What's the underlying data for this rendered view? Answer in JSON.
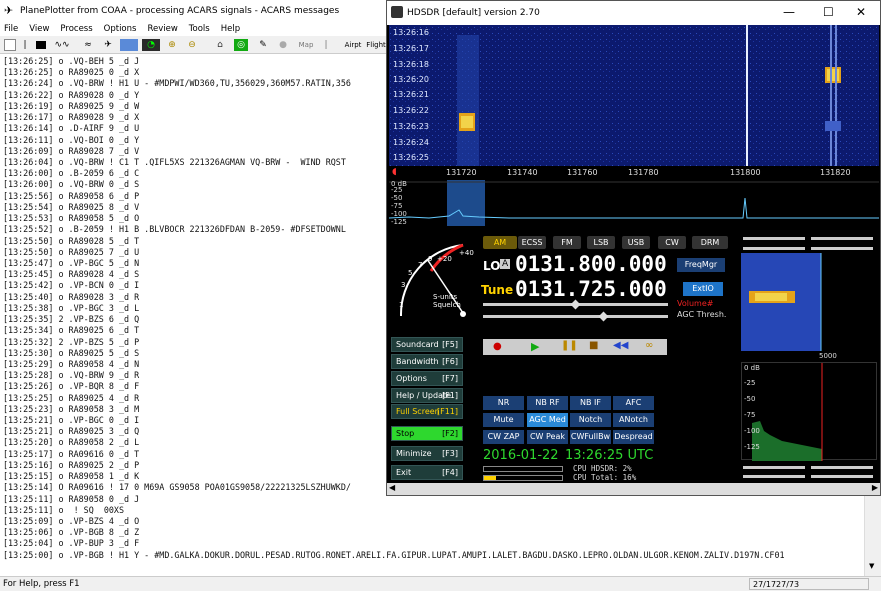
{
  "planeplotter": {
    "title": "PlanePlotter from COAA - processing ACARS signals - ACARS messages",
    "menu": [
      "File",
      "View",
      "Process",
      "Options",
      "Review",
      "Tools",
      "Help"
    ],
    "toolbar_labels": {
      "map": "Map",
      "airport": "Airpt",
      "flight": "Flight"
    },
    "log": [
      "[13:26:25] o .VQ-BEH 5 _d J",
      "[13:26:25] o RA89025 0 _d X",
      "[13:26:24] o .VQ-BRW ! H1 U - #MDPWI/WD360,TU,356029,360M57.RATIN,356",
      "[13:26:22] o RA89028 0 _d Y",
      "[13:26:19] o RA89025 9 _d W",
      "[13:26:17] o RA89028 9 _d X",
      "[13:26:14] o .D-AIRF 9 _d U",
      "[13:26:11] o .VQ-BOI 0 _d Y",
      "[13:26:09] o RA89028 7 _d V",
      "[13:26:04] o .VQ-BRW ! C1 T .QIFL5XS 221326AGMAN VQ-BRW -  WIND RQST",
      "[13:26:00] o .B-2059 6 _d C",
      "[13:26:00] o .VQ-BRW 0 _d S",
      "[13:25:56] o RA89058 6 _d P",
      "[13:25:54] o RA89025 8 _d V",
      "[13:25:53] o RA89058 5 _d O",
      "[13:25:52] o .B-2059 ! H1 B .BLVBOCR 221326DFDAN B-2059- #DFSETDOWNL",
      "[13:25:50] o RA89028 5 _d T",
      "[13:25:50] o RA89025 7 _d U",
      "[13:25:47] o .VP-BGC 5 _d N",
      "[13:25:45] o RA89028 4 _d S",
      "[13:25:42] o .VP-BCN 0 _d I",
      "[13:25:40] o RA89028 3 _d R",
      "[13:25:38] o .VP-BGC 3 _d L",
      "[13:25:35] 2 .VP-BZS 6 _d Q",
      "[13:25:34] o RA89025 6 _d T",
      "[13:25:32] 2 .VP-BZS 5 _d P",
      "[13:25:30] o RA89025 5 _d S",
      "[13:25:29] o RA89058 4 _d N",
      "[13:25:28] o .VQ-BRW 9 _d R",
      "[13:25:26] o .VP-BQR 8 _d F",
      "[13:25:25] o RA89025 4 _d R",
      "[13:25:23] o RA89058 3 _d M",
      "[13:25:21] o .VP-BGC 0 _d I",
      "[13:25:21] o RA89025 3 _d Q",
      "[13:25:20] o RA89058 2 _d L",
      "[13:25:17] o RA09616 0 _d T",
      "[13:25:16] o RA89025 2 _d P",
      "[13:25:15] o RA89058 1 _d K",
      "[13:25:14] O RA09616 ! 17 0 M69A GS9058 POA01GS9058/22221325LSZHUWKD/",
      "[13:25:11] o RA89058 0 _d J",
      "[13:25:11] o  ! SQ  00XS",
      "[13:25:09] o .VP-BZS 4 _d O",
      "[13:25:06] o .VP-BGB 8 _d Z",
      "[13:25:04] o .VP-BUP 3 _d F",
      "[13:25:00] o .VP-BGB ! H1 Y - #MD.GALKA.DOKUR.DORUL.PESAD.RUTOG.RONET.ARELI.FA.GIPUR.LUPAT.AMUPI.LALET.BAGDU.DASKO.LEPRO.OLDAN.ULGOR.KENOM.ZALIV.D197N.CF01"
    ],
    "status_help": "For Help, press F1",
    "status_count": "27/1727/73"
  },
  "hdsdr": {
    "title": "HDSDR [default]  version 2.70",
    "waterfall_times": [
      "13:26:16",
      "13:26:17",
      "13:26:18",
      "13:26:20",
      "13:26:21",
      "13:26:22",
      "13:26:23",
      "13:26:24",
      "13:26:25"
    ],
    "freq_axis": [
      "131720",
      "131740",
      "131760",
      "131780",
      "131800",
      "131820"
    ],
    "spectrum_db": [
      "-25",
      "-50",
      "-75",
      "-100",
      "-125"
    ],
    "spectrum_top_label": "0 dB",
    "modes": [
      "AM",
      "ECSS",
      "FM",
      "LSB",
      "USB",
      "CW",
      "DRM"
    ],
    "lo_label": "LO",
    "lo_a": "A",
    "lo_freq": "0131.800.000",
    "tune_label": "Tune",
    "tune_freq": "0131.725.000",
    "freqmgr": "FreqMgr",
    "extio": "ExtIO",
    "volume": "Volume#",
    "agc_thresh": "AGC Thresh.",
    "smeter_unit": "S-units",
    "smeter_squelch": "Squelch",
    "smeter_scale": [
      "1",
      "3",
      "5",
      "7",
      "9",
      "+20",
      "+40"
    ],
    "left_buttons": [
      {
        "label": "Soundcard",
        "key": "[F5]"
      },
      {
        "label": "Bandwidth",
        "key": "[F6]"
      },
      {
        "label": "Options",
        "key": "[F7]"
      },
      {
        "label": "Help / Update",
        "key": "[F1]"
      },
      {
        "label": "Full Screen",
        "key": "[F11]"
      },
      {
        "label": "Stop",
        "key": "[F2]"
      },
      {
        "label": "Minimize",
        "key": "[F3]"
      },
      {
        "label": "Exit",
        "key": "[F4]"
      }
    ],
    "dsp_buttons": [
      "NR",
      "NB RF",
      "NB IF",
      "AFC",
      "Mute",
      "AGC Med",
      "Notch",
      "ANotch",
      "CW ZAP",
      "CW Peak",
      "CWFullBw",
      "Despread"
    ],
    "date": "2016-01-22",
    "time": "13:26:25 UTC",
    "cpu_hdsdr": "CPU HDSDR:  2%",
    "cpu_total": "CPU Total: 16%",
    "mini_freq": "5000",
    "mini_db": [
      "0 dB",
      "-25",
      "-50",
      "-75",
      "-100",
      "-125"
    ],
    "colors": {
      "accent_green": "#2ed82e",
      "freq_display": "#ffffff",
      "waterfall_bg": "#0c1a6e",
      "button_bg": "#1f3d3a",
      "dsp_bg": "#1b3f74"
    }
  }
}
